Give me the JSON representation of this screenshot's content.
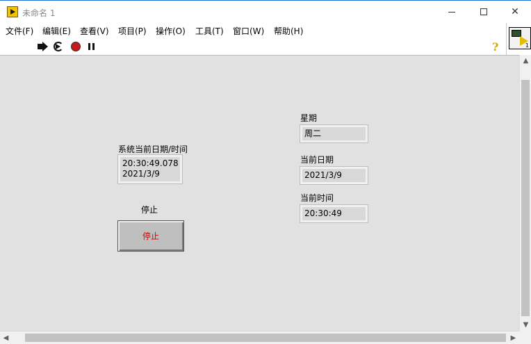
{
  "window": {
    "title": "未命名 1",
    "controls": {
      "minimize": "─",
      "maximize": "☐",
      "close": "✕"
    }
  },
  "menubar": {
    "items": [
      "文件(F)",
      "编辑(E)",
      "查看(V)",
      "项目(P)",
      "操作(O)",
      "工具(T)",
      "窗口(W)",
      "帮助(H)"
    ]
  },
  "toolbar": {
    "icons": [
      "run-icon",
      "run-continuously-icon",
      "abort-icon",
      "pause-icon"
    ],
    "help_glyph": "?"
  },
  "connector": {
    "label": "1"
  },
  "front_panel": {
    "datetime": {
      "label": "系统当前日期/时间",
      "time": "20:30:49.078",
      "date": "2021/3/9"
    },
    "stop": {
      "label": "停止",
      "button_text": "停止",
      "text_color": "#e00000"
    },
    "weekday": {
      "label": "星期",
      "value": "周二"
    },
    "current_date": {
      "label": "当前日期",
      "value": "2021/3/9"
    },
    "current_time": {
      "label": "当前时间",
      "value": "20:30:49"
    }
  },
  "scrollbars": {
    "up": "▲",
    "down": "▼",
    "left": "◀",
    "right": "▶"
  }
}
